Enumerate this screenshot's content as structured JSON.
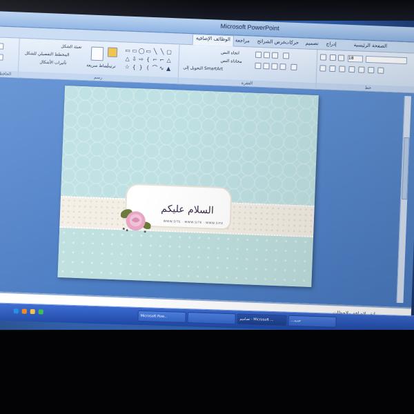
{
  "window": {
    "title": "Microsoft PowerPoint"
  },
  "ribbon_tabs": [
    {
      "label": "الصفحة الرئيسية",
      "active": true
    },
    {
      "label": "إدراج",
      "active": false
    },
    {
      "label": "تصميم",
      "active": false
    },
    {
      "label": "حركات",
      "active": false
    },
    {
      "label": "عرض الشرائح",
      "active": false
    },
    {
      "label": "مراجعة",
      "active": false
    },
    {
      "label": "الوظائف الإضافية",
      "active": false
    }
  ],
  "ribbon_groups": {
    "clipboard_label": "الحافظة",
    "drawing_label": "رسم",
    "paragraph_label": "الفقرة",
    "font_label": "خط",
    "shape_fill": "تعبئة الشكل",
    "shape_outline": "المخطط التفصيلي للشكل",
    "shape_effects": "تأثيرات الأشكال",
    "arrange": "ترتيب",
    "quick_styles": "أنماط سريعة",
    "text_direction": "اتجاه النص",
    "align_text": "محاذاة النص",
    "convert_smartart": "التحويل إلى SmartArt",
    "font_size": "18"
  },
  "slide": {
    "greeting": "السلام عليكم",
    "tagline": "WWW.SITE  ·  WWW.SITE  ·  WWW.SITE",
    "colors": {
      "background": "#bfe1e3",
      "band": "#f4efe6",
      "rose": "#e7a6c4",
      "leaf": "#6c7a3c"
    }
  },
  "notes": {
    "placeholder": "انقر لإضافة ملاحظات"
  },
  "taskbar": {
    "tasks": [
      {
        "label": "Microsoft Pow...",
        "active": false
      },
      {
        "label": "",
        "active": false
      },
      {
        "label": "تصاميم - Microsoft ...",
        "active": true
      },
      {
        "label": "...جديد",
        "active": false
      }
    ],
    "icons": [
      "ie-icon",
      "media-icon",
      "folder-icon",
      "messenger-icon"
    ]
  }
}
